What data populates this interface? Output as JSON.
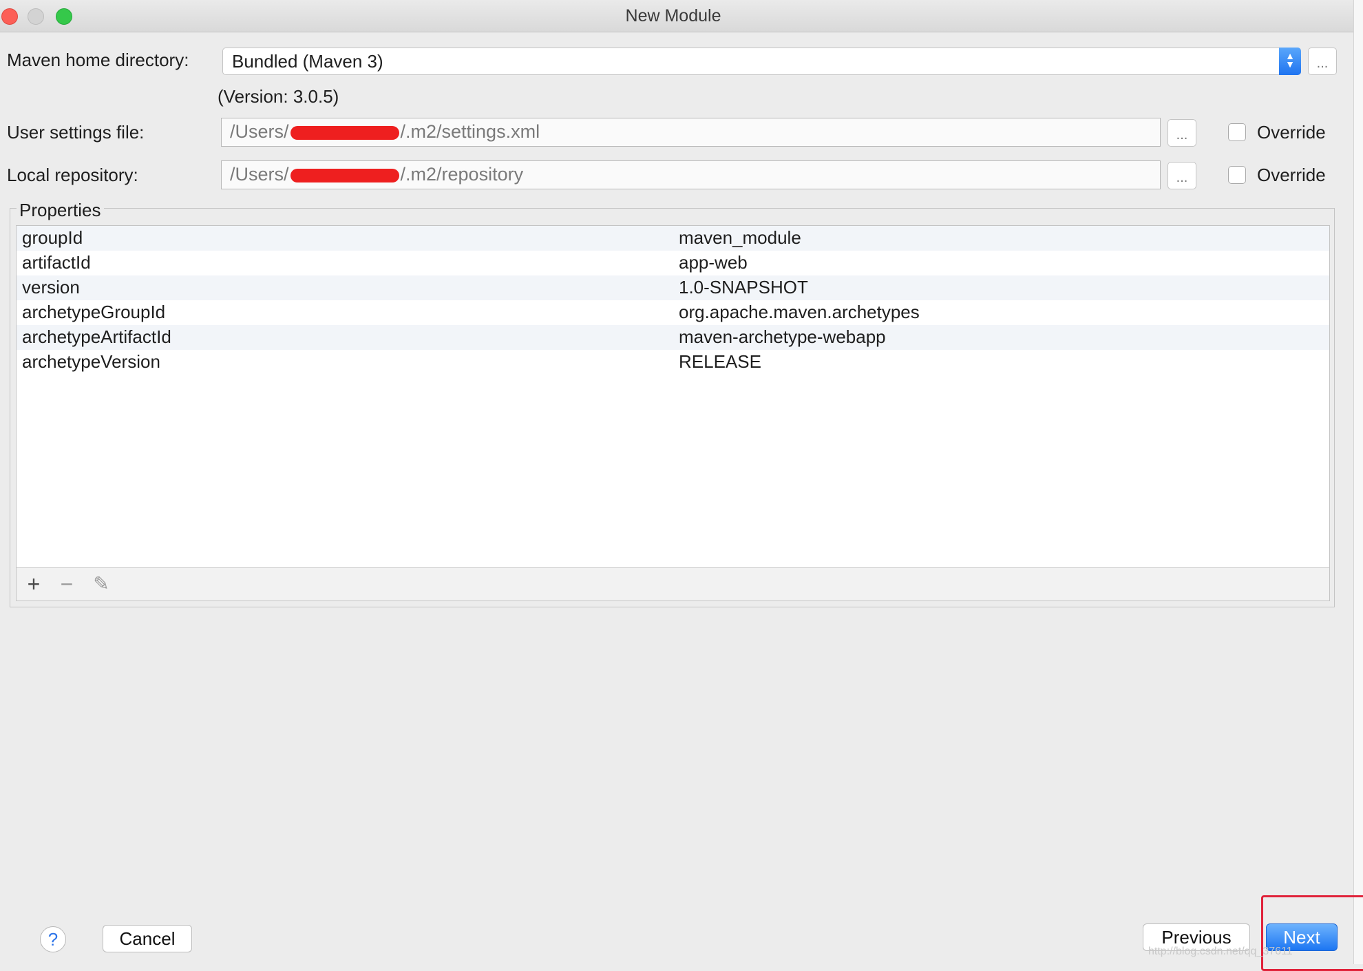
{
  "window": {
    "title": "New Module"
  },
  "maven": {
    "home_label": "Maven home directory:",
    "home_value": "Bundled (Maven 3)",
    "version_text": "(Version: 3.0.5)",
    "browse_label": "..."
  },
  "user_settings": {
    "label": "User settings file:",
    "value_prefix": "/Users/",
    "value_suffix": "/.m2/settings.xml",
    "browse_label": "...",
    "override_label": "Override"
  },
  "local_repo": {
    "label": "Local repository:",
    "value_prefix": "/Users/",
    "value_suffix": "/.m2/repository",
    "browse_label": "...",
    "override_label": "Override"
  },
  "properties": {
    "title": "Properties",
    "rows": [
      {
        "key": "groupId",
        "value": "maven_module"
      },
      {
        "key": "artifactId",
        "value": "app-web"
      },
      {
        "key": "version",
        "value": "1.0-SNAPSHOT"
      },
      {
        "key": "archetypeGroupId",
        "value": "org.apache.maven.archetypes"
      },
      {
        "key": "archetypeArtifactId",
        "value": "maven-archetype-webapp"
      },
      {
        "key": "archetypeVersion",
        "value": "RELEASE"
      }
    ],
    "toolbar": {
      "add": "+",
      "remove": "−",
      "edit": "✎"
    }
  },
  "footer": {
    "help": "?",
    "cancel": "Cancel",
    "previous": "Previous",
    "next": "Next"
  },
  "watermark": "http://blog.csdn.net/qq_37611",
  "colors": {
    "accent": "#1d76f2",
    "highlight": "#e0223a",
    "redaction": "#ee1f1f"
  },
  "icons": [
    "close-window-icon",
    "minimize-window-icon",
    "maximize-window-icon",
    "add-icon",
    "remove-icon",
    "edit-icon",
    "help-icon"
  ]
}
